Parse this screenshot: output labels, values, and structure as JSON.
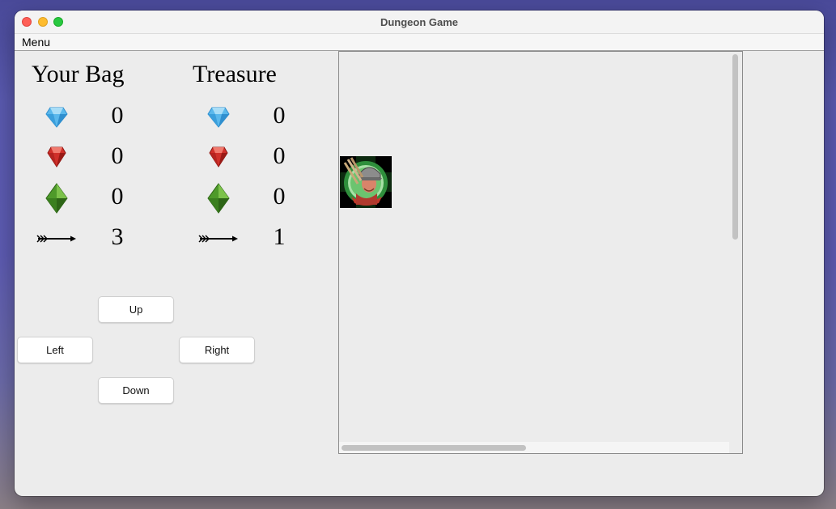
{
  "window": {
    "title": "Dungeon Game"
  },
  "menubar": {
    "menu_label": "Menu"
  },
  "bag": {
    "heading": "Your Bag",
    "items": [
      {
        "icon": "sapphire-icon",
        "count": "0"
      },
      {
        "icon": "ruby-icon",
        "count": "0"
      },
      {
        "icon": "emerald-icon",
        "count": "0"
      },
      {
        "icon": "arrow-icon",
        "count": "3"
      }
    ]
  },
  "treasure": {
    "heading": "Treasure",
    "items": [
      {
        "icon": "sapphire-icon",
        "count": "0"
      },
      {
        "icon": "ruby-icon",
        "count": "0"
      },
      {
        "icon": "emerald-icon",
        "count": "0"
      },
      {
        "icon": "arrow-icon",
        "count": "1"
      }
    ]
  },
  "controls": {
    "up": "Up",
    "left": "Left",
    "right": "Right",
    "down": "Down"
  },
  "map": {
    "player_icon": "archer-player-icon"
  },
  "colors": {
    "sapphire": "#5ab8ec",
    "ruby": "#d0302a",
    "emerald": "#4e9a2a"
  }
}
